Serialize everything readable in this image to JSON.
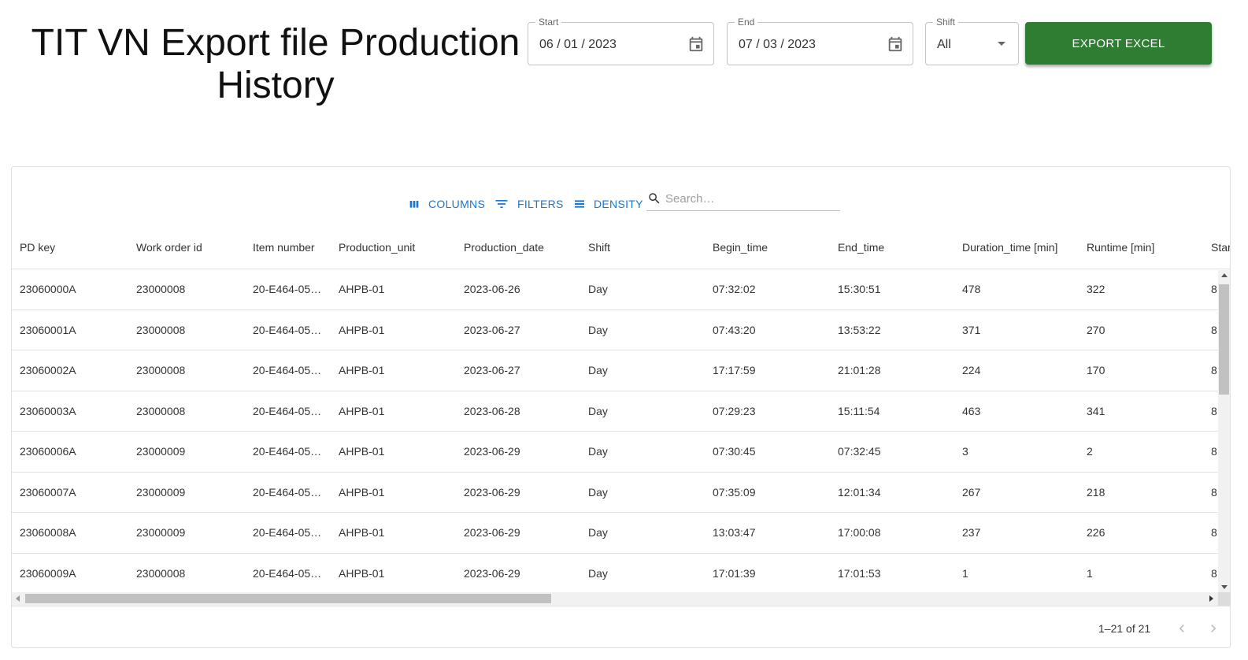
{
  "page": {
    "title": "TIT VN Export file Production History"
  },
  "filters": {
    "start": {
      "label": "Start",
      "value": "06 / 01 / 2023"
    },
    "end": {
      "label": "End",
      "value": "07 / 03 / 2023"
    },
    "shift": {
      "label": "Shift",
      "value": "All"
    }
  },
  "export_button": {
    "label": "EXPORT EXCEL",
    "color": "#2e7d32"
  },
  "toolbar": {
    "columns_label": "COLUMNS",
    "filters_label": "FILTERS",
    "density_label": "DENSITY",
    "search_placeholder": "Search…",
    "accent_color": "#1976d2"
  },
  "table": {
    "columns": [
      "PD key",
      "Work order id",
      "Item number",
      "Production_unit",
      "Production_date",
      "Shift",
      "Begin_time",
      "End_time",
      "Duration_time [min]",
      "Runtime [min]",
      "Star"
    ],
    "rows": [
      [
        "23060000A",
        "23000008",
        "20-E464-05…",
        "AHPB-01",
        "2023-06-26",
        "Day",
        "07:32:02",
        "15:30:51",
        "478",
        "322",
        "8"
      ],
      [
        "23060001A",
        "23000008",
        "20-E464-05…",
        "AHPB-01",
        "2023-06-27",
        "Day",
        "07:43:20",
        "13:53:22",
        "371",
        "270",
        "8"
      ],
      [
        "23060002A",
        "23000008",
        "20-E464-05…",
        "AHPB-01",
        "2023-06-27",
        "Day",
        "17:17:59",
        "21:01:28",
        "224",
        "170",
        "8"
      ],
      [
        "23060003A",
        "23000008",
        "20-E464-05…",
        "AHPB-01",
        "2023-06-28",
        "Day",
        "07:29:23",
        "15:11:54",
        "463",
        "341",
        "8"
      ],
      [
        "23060006A",
        "23000009",
        "20-E464-05…",
        "AHPB-01",
        "2023-06-29",
        "Day",
        "07:30:45",
        "07:32:45",
        "3",
        "2",
        "8"
      ],
      [
        "23060007A",
        "23000009",
        "20-E464-05…",
        "AHPB-01",
        "2023-06-29",
        "Day",
        "07:35:09",
        "12:01:34",
        "267",
        "218",
        "8"
      ],
      [
        "23060008A",
        "23000009",
        "20-E464-05…",
        "AHPB-01",
        "2023-06-29",
        "Day",
        "13:03:47",
        "17:00:08",
        "237",
        "226",
        "8"
      ],
      [
        "23060009A",
        "23000008",
        "20-E464-05…",
        "AHPB-01",
        "2023-06-29",
        "Day",
        "17:01:39",
        "17:01:53",
        "1",
        "1",
        "8"
      ]
    ]
  },
  "pagination": {
    "text": "1–21 of 21"
  },
  "icons": {
    "date_picker": "calendar-icon",
    "shift_dropdown": "caret-down-icon",
    "columns": "columns-icon",
    "filters": "filter-icon",
    "density": "density-icon",
    "search": "search-icon",
    "prev": "chevron-left-icon",
    "next": "chevron-right-icon"
  }
}
